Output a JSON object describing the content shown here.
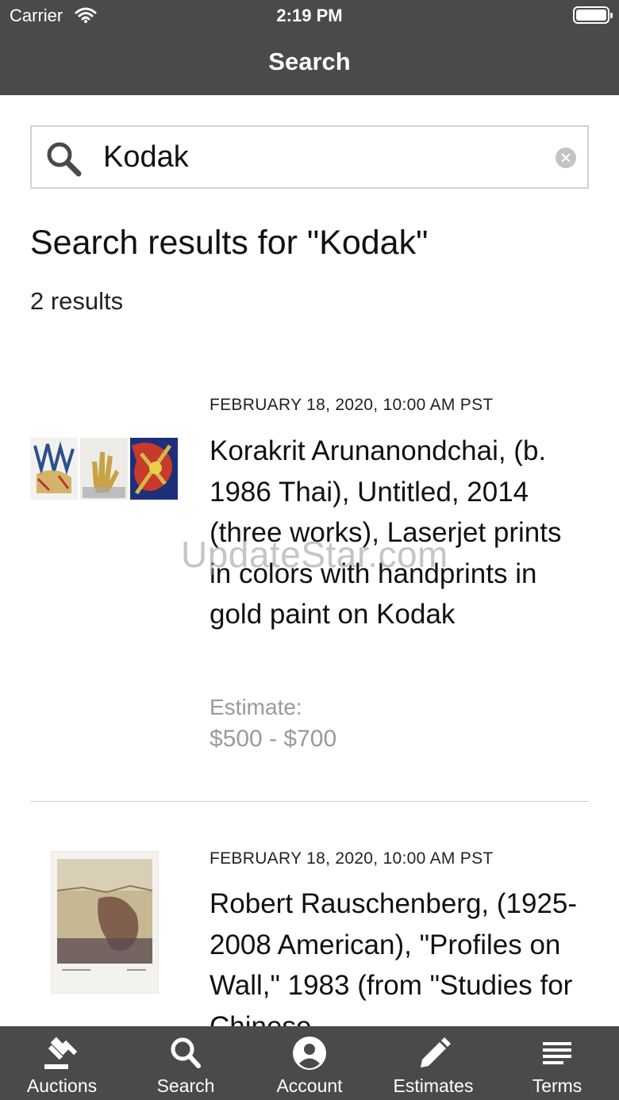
{
  "status_bar": {
    "carrier": "Carrier",
    "time": "2:19 PM"
  },
  "nav": {
    "title": "Search"
  },
  "search": {
    "value": "Kodak",
    "placeholder": ""
  },
  "results": {
    "heading": "Search results for \"Kodak\"",
    "count": "2 results",
    "items": [
      {
        "date": "FEBRUARY 18, 2020, 10:00 AM PST",
        "title": "Korakrit Arunanondchai, (b. 1986 Thai), Untitled, 2014 (three works), Laserjet prints in colors with handprints in gold paint on Kodak",
        "estimate_label": "Estimate:",
        "estimate_value": "$500 - $700"
      },
      {
        "date": "FEBRUARY 18, 2020, 10:00 AM PST",
        "title": "Robert Rauschenberg, (1925-2008 American), \"Profiles on Wall,\" 1983 (from \"Studies for Chinese",
        "estimate_label": "",
        "estimate_value": ""
      }
    ]
  },
  "watermark": "UpdateStar.com",
  "tabs": [
    {
      "label": "Auctions",
      "icon": "gavel-icon"
    },
    {
      "label": "Search",
      "icon": "search-icon"
    },
    {
      "label": "Account",
      "icon": "account-icon"
    },
    {
      "label": "Estimates",
      "icon": "pencil-icon"
    },
    {
      "label": "Terms",
      "icon": "list-icon"
    }
  ]
}
